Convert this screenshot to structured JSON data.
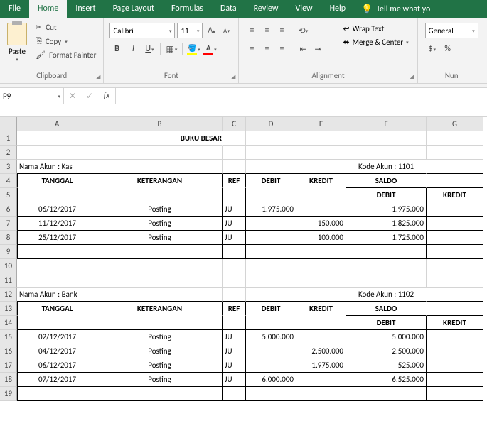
{
  "menu": {
    "tabs": [
      "File",
      "Home",
      "Insert",
      "Page Layout",
      "Formulas",
      "Data",
      "Review",
      "View",
      "Help"
    ],
    "active": "Home",
    "tellme": "Tell me what yo"
  },
  "ribbon": {
    "clipboard": {
      "label": "Clipboard",
      "paste": "Paste",
      "cut": "Cut",
      "copy": "Copy",
      "painter": "Format Painter"
    },
    "font": {
      "label": "Font",
      "name": "Calibri",
      "size": "11"
    },
    "alignment": {
      "label": "Alignment",
      "wrap": "Wrap Text",
      "merge": "Merge & Center"
    },
    "number": {
      "label": "Nun",
      "format": "General"
    }
  },
  "namebox": "P9",
  "columns": [
    "A",
    "B",
    "C",
    "D",
    "E",
    "F",
    "G"
  ],
  "sheet": {
    "title": "BUKU BESAR",
    "acct1": {
      "name": "Nama Akun : Kas",
      "code": "Kode Akun : 1101"
    },
    "acct2": {
      "name": "Nama Akun : Bank",
      "code": "Kode Akun : 1102"
    },
    "hdr": {
      "tanggal": "TANGGAL",
      "ket": "KETERANGAN",
      "ref": "REF",
      "debit": "DEBIT",
      "kredit": "KREDIT",
      "saldo": "SALDO"
    },
    "r6": {
      "a": "06/12/2017",
      "b": "Posting",
      "c": "JU",
      "d": "1.975.000",
      "e": "",
      "f": "1.975.000"
    },
    "r7": {
      "a": "11/12/2017",
      "b": "Posting",
      "c": "JU",
      "d": "",
      "e": "150.000",
      "f": "1.825.000"
    },
    "r8": {
      "a": "25/12/2017",
      "b": "Posting",
      "c": "JU",
      "d": "",
      "e": "100.000",
      "f": "1.725.000"
    },
    "r15": {
      "a": "02/12/2017",
      "b": "Posting",
      "c": "JU",
      "d": "5.000.000",
      "e": "",
      "f": "5.000.000"
    },
    "r16": {
      "a": "04/12/2017",
      "b": "Posting",
      "c": "JU",
      "d": "",
      "e": "2.500.000",
      "f": "2.500.000"
    },
    "r17": {
      "a": "06/12/2017",
      "b": "Posting",
      "c": "JU",
      "d": "",
      "e": "1.975.000",
      "f": "525.000"
    },
    "r18": {
      "a": "07/12/2017",
      "b": "Posting",
      "c": "JU",
      "d": "6.000.000",
      "e": "",
      "f": "6.525.000"
    }
  }
}
